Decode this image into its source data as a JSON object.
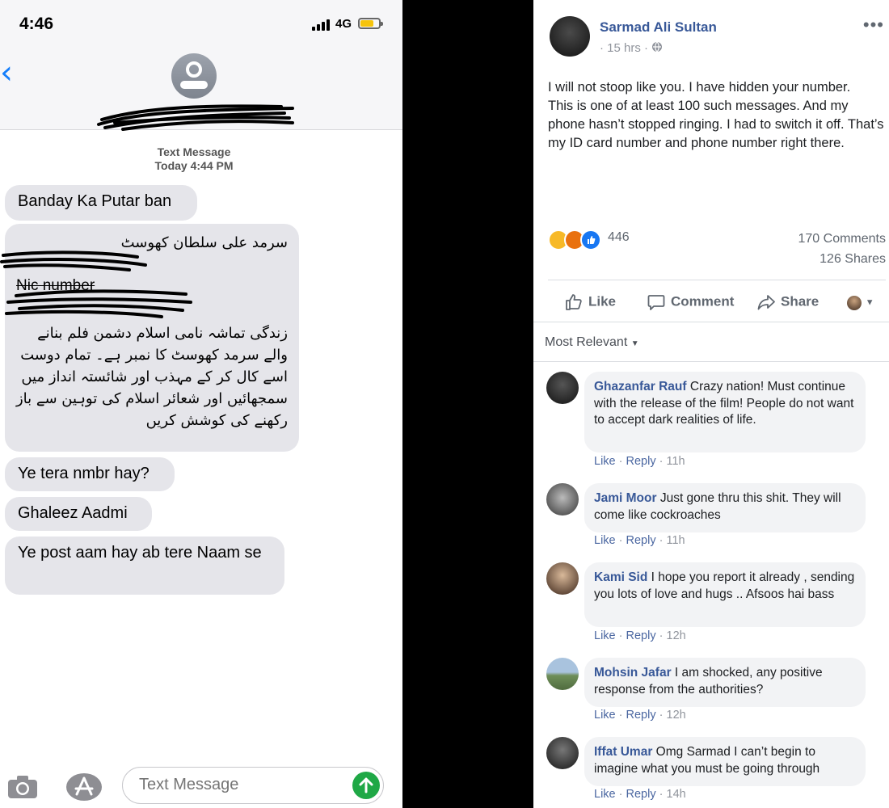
{
  "imessage": {
    "status_time": "4:46",
    "network": "4G",
    "meta_label": "Text Message",
    "meta_time": "Today 4:44 PM",
    "messages": [
      "Banday Ka Putar ban",
      "Ye tera nmbr hay?",
      "Ghaleez Aadmi",
      "Ye post  aam hay ab tere Naam se"
    ],
    "urdu_name": "سرمد علی سلطان کھوسٹ",
    "nic_label": "Nic number",
    "urdu_body": "زندگی تماشہ نامی اسلام دشمن فلم بنانے والے سرمد کھوسٹ کا نمبر ہے۔ تمام دوست اسے کال کر کے مہذب اور شائستہ انداز میں سمجھائیں اور شعائر اسلام کی توہین سے باز رکھنے کی کوشش کریں",
    "compose_placeholder": "Text Message",
    "colors": {
      "accent": "#147efb",
      "bubble": "#e5e5ea",
      "send": "#1fa846"
    }
  },
  "facebook": {
    "author": "Sarmad Ali Sultan",
    "time": "15 hrs",
    "post_lines": [
      "I will not stoop like you. I have hidden your number.",
      "This is one of at least 100 such messages. And my phone hasn’t stopped ringing. I had to switch it off. That’s my ID card number and phone number right there."
    ],
    "reaction_count": "446",
    "comments_count": "170 Comments",
    "shares_count": "126 Shares",
    "actions": {
      "like": "Like",
      "comment": "Comment",
      "share": "Share"
    },
    "sort_label": "Most Relevant",
    "comment_like": "Like",
    "comment_reply": "Reply",
    "comments": [
      {
        "name": "Ghazanfar Rauf",
        "text": "Crazy nation! Must continue with the release of the film! People do not want to accept dark realities of life.",
        "time": "11h"
      },
      {
        "name": "Jami Moor",
        "text": "Just gone thru this shit. They will come like cockroaches",
        "time": "11h"
      },
      {
        "name": "Kami Sid",
        "text": "I hope you report it already , sending you lots of love and hugs .. Afsoos hai bass",
        "time": "12h"
      },
      {
        "name": "Mohsin Jafar",
        "text": "I am shocked, any positive response from the authorities?",
        "time": "12h"
      },
      {
        "name": "Iffat Umar",
        "text": "Omg Sarmad I can’t begin to imagine what you must be going through",
        "time": "14h"
      }
    ],
    "colors": {
      "link": "#385898",
      "meta": "#90949c",
      "like_blue": "#1877f2"
    }
  }
}
